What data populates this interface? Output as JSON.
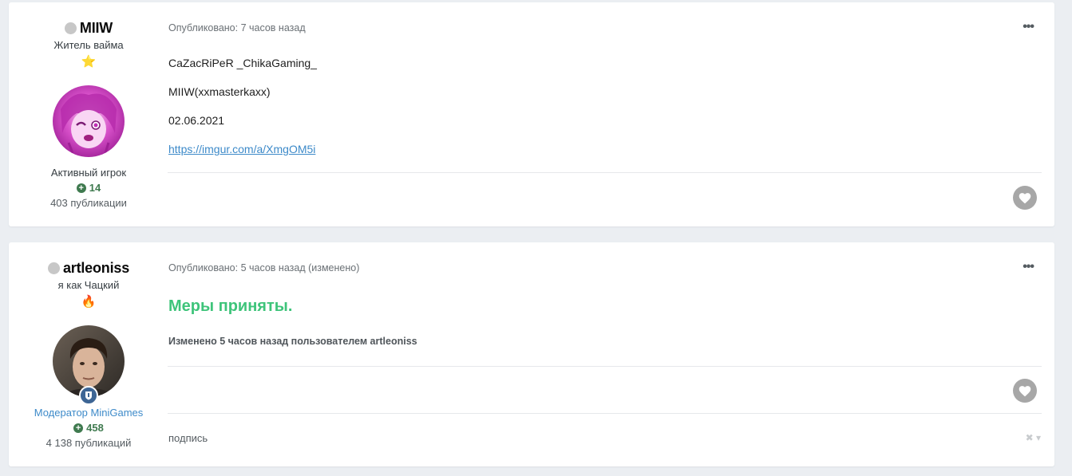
{
  "posts": [
    {
      "author": {
        "name": "MIIW",
        "title": "Житель вайма",
        "rank_icon": "⭐",
        "rank_icon_name": "star-icon",
        "group": "Активный игрок",
        "reputation": "14",
        "posts_count": "403 публикации"
      },
      "published": "Опубликовано: 7 часов назад",
      "content": {
        "line1": "CaZacRiPeR _ChikaGaming_",
        "line2": "MIIW(xxmasterkaxx)",
        "line3": "02.06.2021",
        "link": "https://imgur.com/a/XmgOM5i"
      },
      "more_label": "•••"
    },
    {
      "author": {
        "name": "artleoniss",
        "title": "я как Чацкий",
        "rank_icon": "🔥",
        "rank_icon_name": "fire-icon",
        "group": "Модератор MiniGames",
        "reputation": "458",
        "posts_count": "4 138 публикаций"
      },
      "published": "Опубликовано: 5 часов назад (изменено)",
      "content": {
        "headline": "Меры приняты.",
        "edited_note": "Изменено 5 часов назад пользователем artleoniss",
        "signature": "подпись"
      },
      "more_label": "•••",
      "sig_controls": "✖ ▾"
    }
  ],
  "colors": {
    "background": "#ebeef2",
    "headline_green": "#3ec47a",
    "reputation_green": "#3f7a4f",
    "moderator_blue": "#3d8ac9",
    "link_blue": "#3d8ac9",
    "like_gray": "#a7a7a7"
  }
}
